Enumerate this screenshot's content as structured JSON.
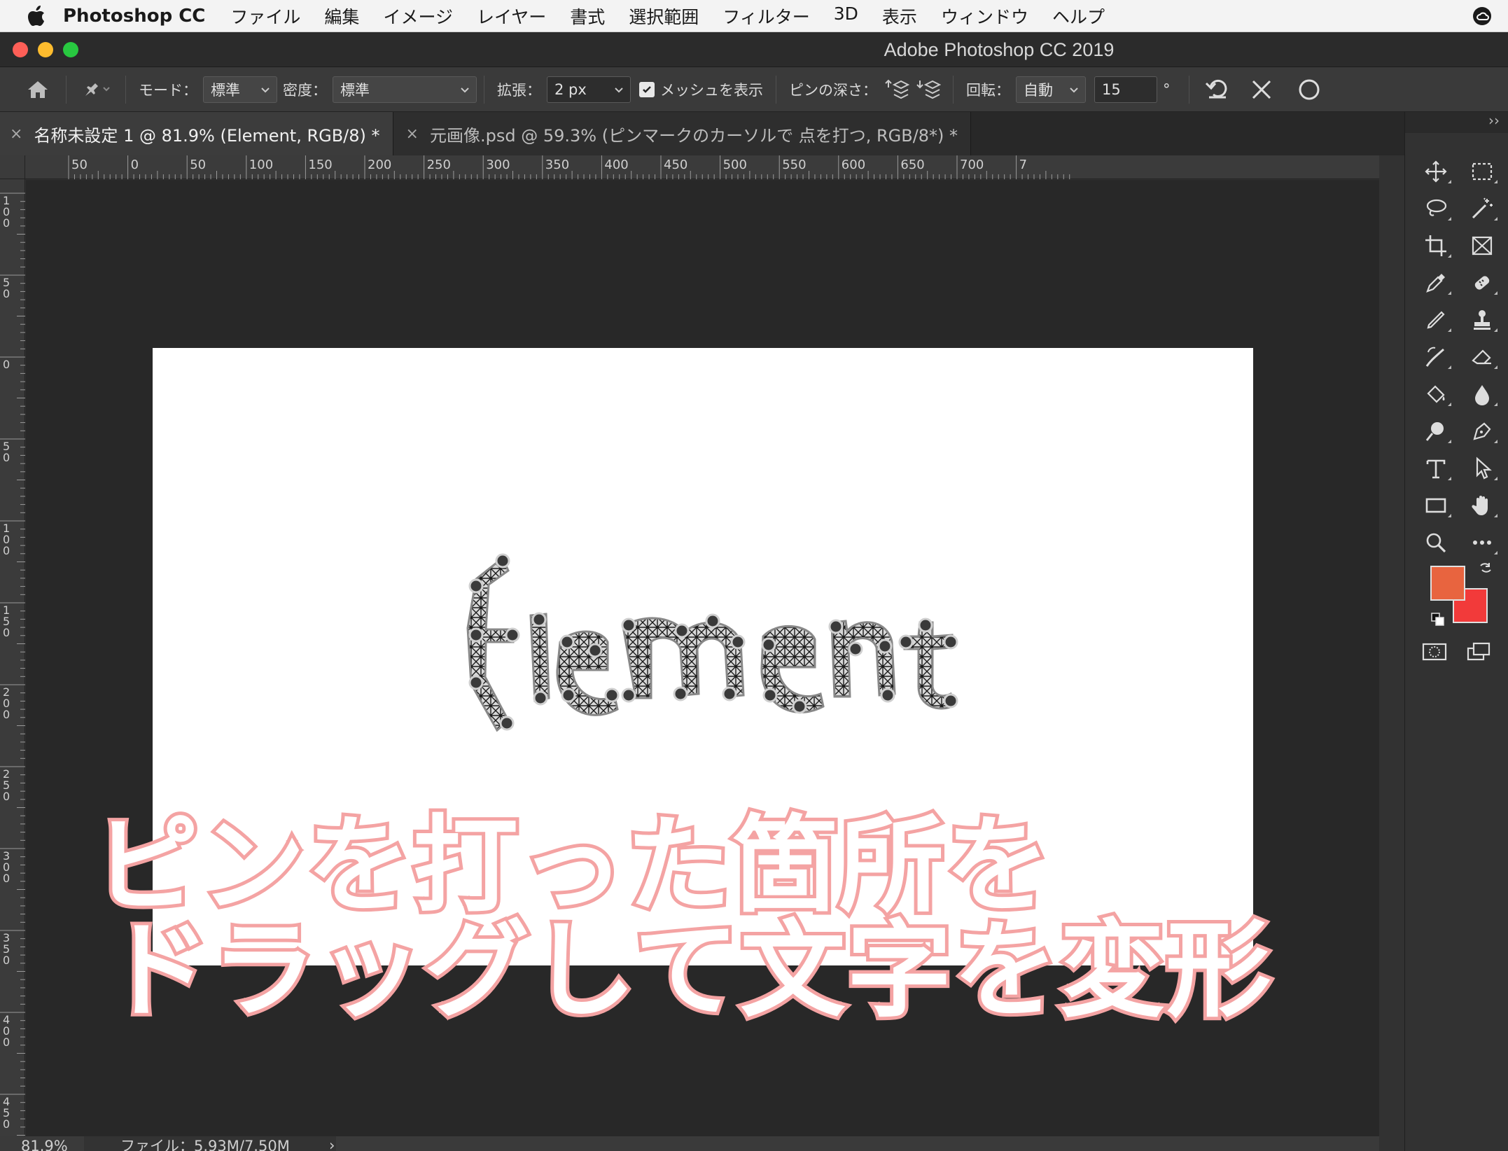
{
  "menubar": {
    "app_name": "Photoshop CC",
    "items": [
      "ファイル",
      "編集",
      "イメージ",
      "レイヤー",
      "書式",
      "選択範囲",
      "フィルター",
      "3D",
      "表示",
      "ウィンドウ",
      "ヘルプ"
    ]
  },
  "window": {
    "title": "Adobe Photoshop CC 2019"
  },
  "options": {
    "mode_label": "モード：",
    "mode_value": "標準",
    "density_label": "密度：",
    "density_value": "標準",
    "expand_label": "拡張：",
    "expand_value": "2 px",
    "show_mesh_label": "メッシュを表示",
    "show_mesh_checked": true,
    "pin_depth_label": "ピンの深さ：",
    "rotate_label": "回転：",
    "rotate_value": "自動",
    "angle_value": "15",
    "degree_symbol": "°"
  },
  "tabs": [
    {
      "title": "名称未設定 1 @ 81.9% (Element, RGB/8) *",
      "active": true
    },
    {
      "title": "元画像.psd @ 59.3% (ピンマークのカーソルで 点を打つ, RGB/8*) *",
      "active": false
    }
  ],
  "ruler_top_labels": [
    "50",
    "0",
    "50",
    "100",
    "150",
    "200",
    "250",
    "300",
    "350",
    "400",
    "450",
    "500",
    "550",
    "600",
    "650",
    "700",
    "7"
  ],
  "ruler_left_labels": [
    "1\n0\n0",
    "5\n0",
    "0",
    "5\n0",
    "1\n0\n0",
    "1\n5\n0",
    "2\n0\n0",
    "2\n5\n0",
    "3\n0\n0",
    "3\n5\n0",
    "4\n0\n0",
    "4\n5\n0"
  ],
  "canvas": {
    "artwork_text": "Element"
  },
  "caption": {
    "line1": "ピンを打った箇所を",
    "line2": "ドラッグして文字を変形"
  },
  "status": {
    "zoom": "81.9%",
    "file_info": "ファイル：5.93M/7.50M",
    "arrow": "›"
  },
  "tools": [
    "move-tool",
    "marquee-tool",
    "lasso-tool",
    "magic-wand-tool",
    "crop-tool",
    "frame-tool",
    "eyedropper-tool",
    "healing-brush-tool",
    "brush-tool",
    "clone-stamp-tool",
    "history-brush-tool",
    "eraser-tool",
    "paint-bucket-tool",
    "blur-tool",
    "dodge-tool",
    "pen-tool",
    "type-tool",
    "path-selection-tool",
    "rectangle-tool",
    "hand-tool",
    "zoom-tool",
    "more-tools"
  ],
  "colors": {
    "foreground": "#e8643f",
    "background": "#f23a3a",
    "caption_stroke": "#f4a3a3"
  }
}
